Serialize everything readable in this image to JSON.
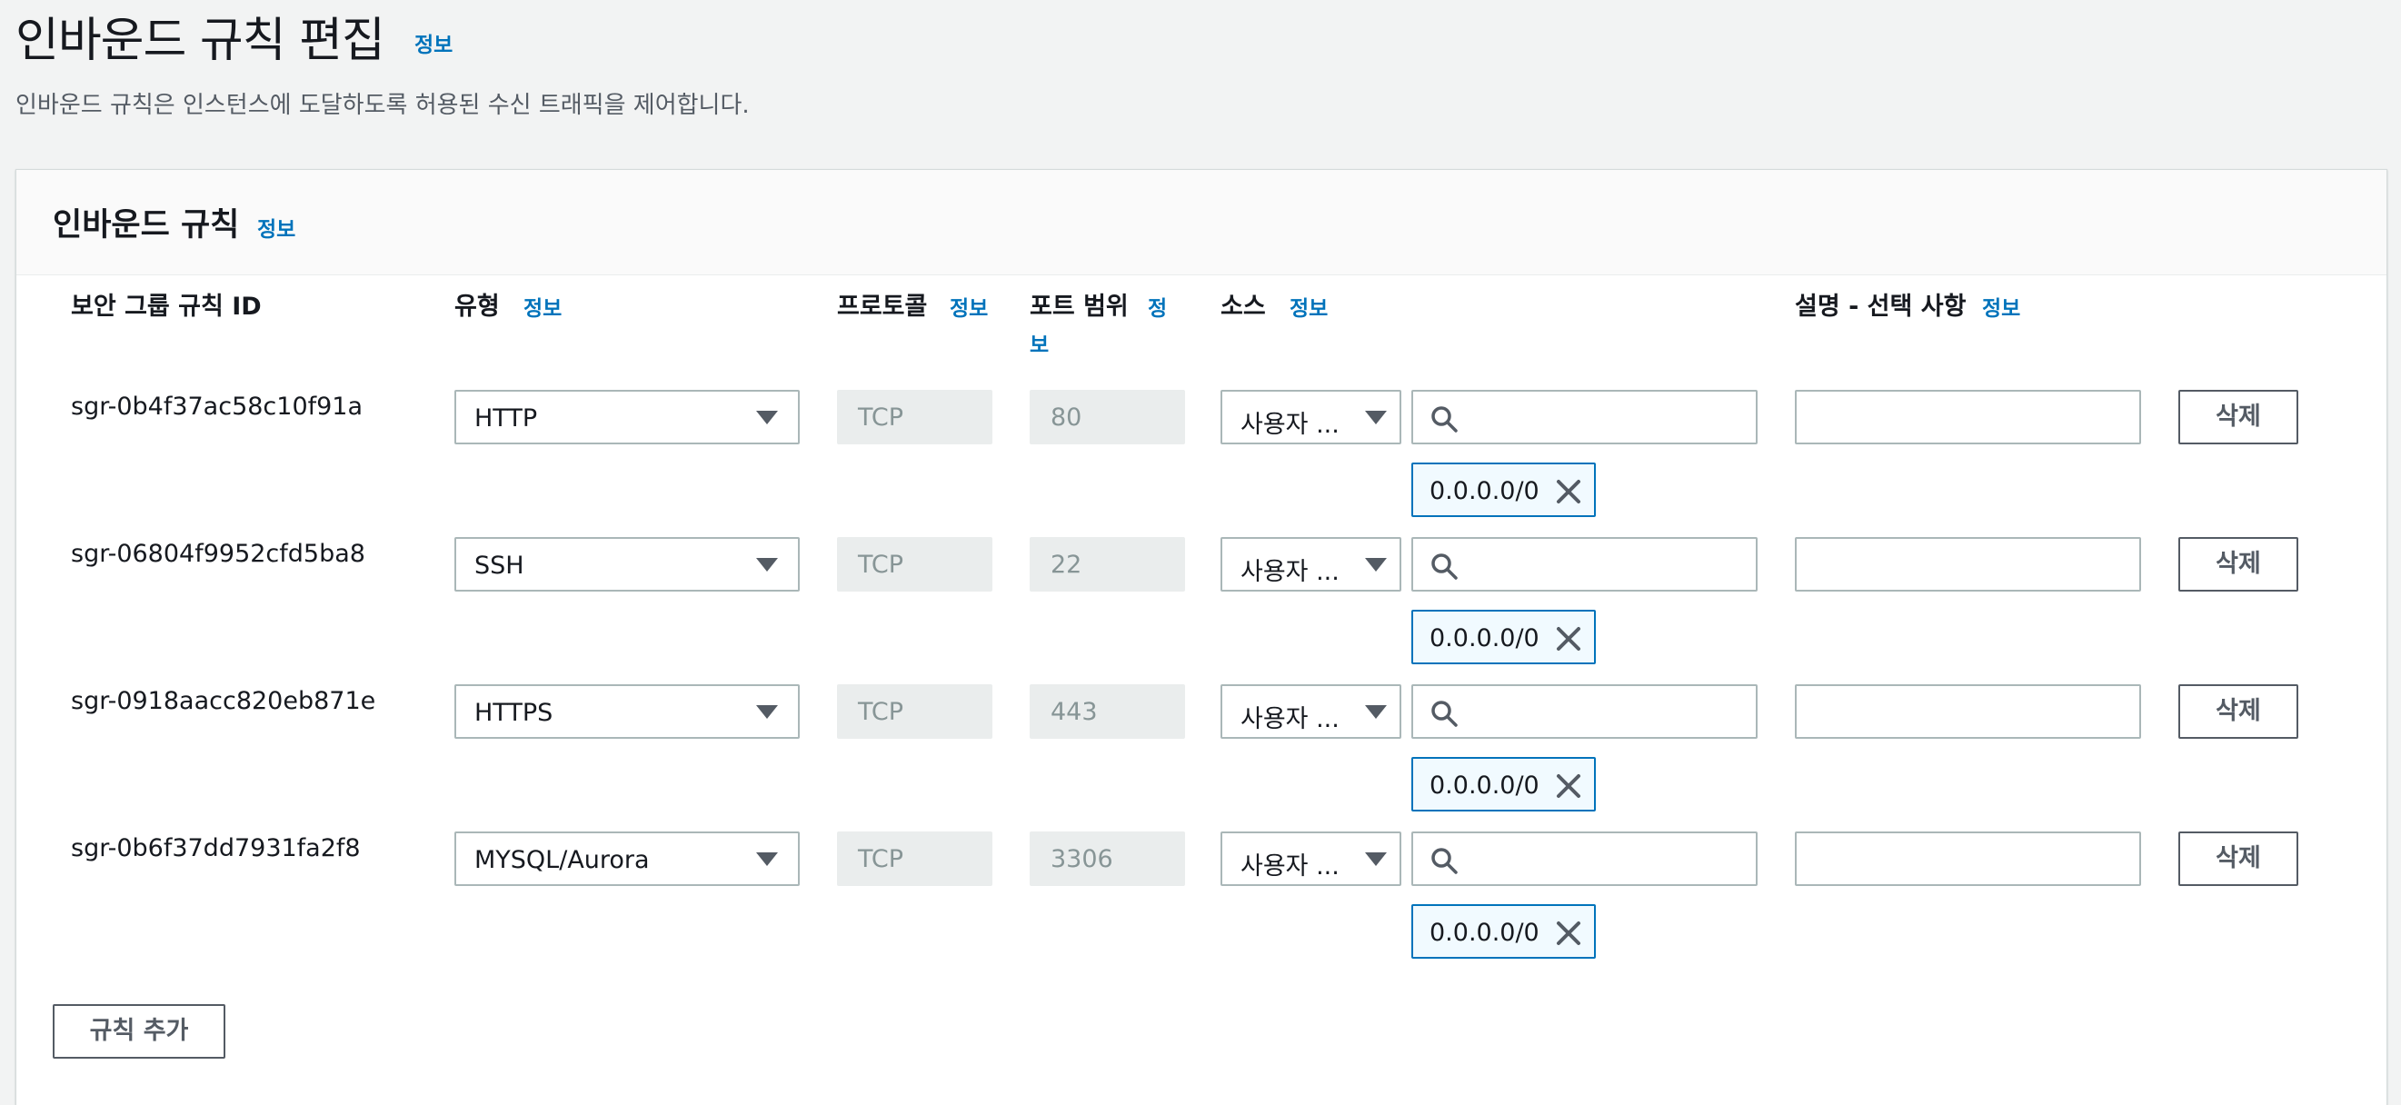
{
  "page": {
    "title": "인바운드 규칙 편집",
    "title_info": "정보",
    "description": "인바운드 규칙은 인스턴스에 도달하도록 허용된 수신 트래픽을 제어합니다."
  },
  "panel": {
    "title": "인바운드 규칙",
    "title_info": "정보",
    "columns": {
      "rule_id": "보안 그룹 규칙 ID",
      "type": "유형",
      "protocol": "프로토콜",
      "port_range": "포트 범위",
      "source": "소스",
      "description": "설명 - 선택 사항"
    },
    "info_label": "정보",
    "port_info_line1": "정",
    "port_info_line2": "보",
    "rows": [
      {
        "id": "sgr-0b4f37ac58c10f91a",
        "type": "HTTP",
        "protocol": "TCP",
        "port": "80",
        "source_type": "사용자 ...",
        "search_value": "",
        "cidr": "0.0.0.0/0",
        "description": "",
        "delete_label": "삭제"
      },
      {
        "id": "sgr-06804f9952cfd5ba8",
        "type": "SSH",
        "protocol": "TCP",
        "port": "22",
        "source_type": "사용자 ...",
        "search_value": "",
        "cidr": "0.0.0.0/0",
        "description": "",
        "delete_label": "삭제"
      },
      {
        "id": "sgr-0918aacc820eb871e",
        "type": "HTTPS",
        "protocol": "TCP",
        "port": "443",
        "source_type": "사용자 ...",
        "search_value": "",
        "cidr": "0.0.0.0/0",
        "description": "",
        "delete_label": "삭제"
      },
      {
        "id": "sgr-0b6f37dd7931fa2f8",
        "type": "MYSQL/Aurora",
        "protocol": "TCP",
        "port": "3306",
        "source_type": "사용자 ...",
        "search_value": "",
        "cidr": "0.0.0.0/0",
        "description": "",
        "delete_label": "삭제"
      }
    ],
    "add_rule_label": "규칙 추가"
  },
  "colors": {
    "link": "#0073bb",
    "token_border": "#0073bb",
    "token_bg": "#f1faff",
    "page_bg": "#f2f3f3"
  }
}
